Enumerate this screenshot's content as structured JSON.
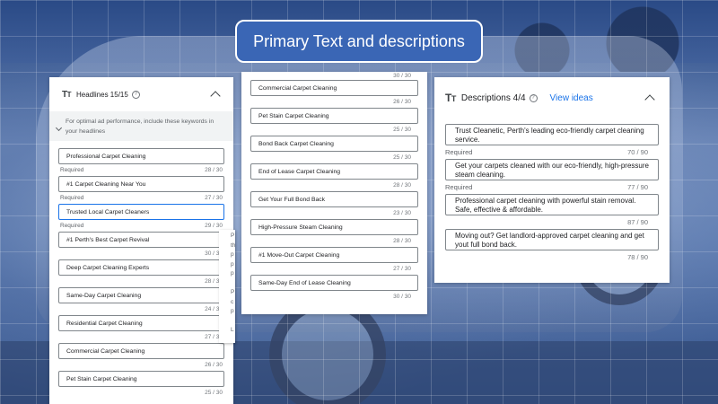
{
  "title": "Primary Text and descriptions",
  "headlines": {
    "title": "Headlines 15/15",
    "keyword_hint": "For optimal ad performance, include these keywords in your headlines",
    "items": [
      {
        "text": "Professional Carpet Cleaning",
        "required": true,
        "count": "28 / 30"
      },
      {
        "text": "#1 Carpet Cleaning Near You",
        "required": true,
        "count": "27 / 30"
      },
      {
        "text": "Trusted Local Carpet Cleaners",
        "required": true,
        "count": "29 / 30"
      },
      {
        "text": "#1 Perth's Best Carpet Revival",
        "required": false,
        "count": "30 / 30"
      },
      {
        "text": "Deep Carpet Cleaning Experts",
        "required": false,
        "count": "28 / 30"
      },
      {
        "text": "Same-Day Carpet Cleaning",
        "required": false,
        "count": "24 / 30"
      },
      {
        "text": "Residential Carpet Cleaning",
        "required": false,
        "count": "27 / 30"
      },
      {
        "text": "Commercial Carpet Cleaning",
        "required": false,
        "count": "26 / 30"
      },
      {
        "text": "Pet Stain Carpet Cleaning",
        "required": false,
        "count": "25 / 30"
      }
    ],
    "required_label": "Required",
    "tooltip_fragment": [
      "P",
      "th",
      "p",
      "p",
      "p",
      "",
      "P",
      "c",
      "p",
      "",
      "L"
    ]
  },
  "headlines_cont": {
    "top_count": "30 / 30",
    "items": [
      {
        "text": "Commercial Carpet Cleaning",
        "count": "26 / 30"
      },
      {
        "text": "Pet Stain Carpet Cleaning",
        "count": "25 / 30"
      },
      {
        "text": "Bond Back Carpet Cleaning",
        "count": "25 / 30"
      },
      {
        "text": "End of Lease Carpet Cleaning",
        "count": "28 / 30"
      },
      {
        "text": "Get Your Full Bond Back",
        "count": "23 / 30"
      },
      {
        "text": "High-Pressure Steam Cleaning",
        "count": "28 / 30"
      },
      {
        "text": "#1 Move-Out Carpet Cleaning",
        "count": "27 / 30"
      },
      {
        "text": "Same-Day End of Lease Cleaning",
        "count": "30 / 30"
      }
    ]
  },
  "descriptions": {
    "title": "Descriptions 4/4",
    "view_ideas": "View ideas",
    "required_label": "Required",
    "items": [
      {
        "text": "Trust Cleanetic, Perth's leading eco-friendly carpet cleaning service.",
        "required": true,
        "count": "70 / 90"
      },
      {
        "text": "Get your carpets cleaned with our eco-friendly, high-pressure steam cleaning.",
        "required": true,
        "count": "77 / 90"
      },
      {
        "text": "Professional carpet cleaning with powerful stain removal. Safe, effective & affordable.",
        "required": false,
        "count": "87 / 90"
      },
      {
        "text": "Moving out? Get landlord-approved carpet cleaning and get yout full bond back.",
        "required": false,
        "count": "78 / 90"
      }
    ]
  },
  "colors": {
    "accent": "#1a73e8",
    "title_pill_bg": "#3a66b5"
  }
}
